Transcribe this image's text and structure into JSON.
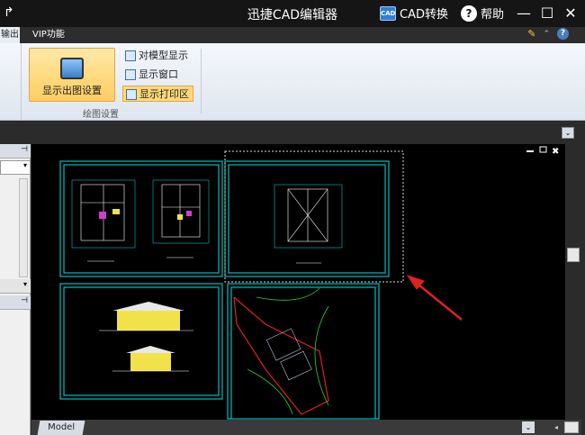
{
  "titlebar": {
    "title": "迅捷CAD编辑器",
    "left_icon": "share-arrow-icon",
    "cad_convert_label": "CAD转换",
    "help_label": "帮助",
    "cad_icon_text": "CAD"
  },
  "tabs": {
    "first_label": "输出",
    "vip_label": "VIP功能"
  },
  "ribbon": {
    "big_button_label": "显示出图设置",
    "items": [
      {
        "label": "对模型显示",
        "active": false
      },
      {
        "label": "显示窗口",
        "active": false
      },
      {
        "label": "显示打印区",
        "active": true
      }
    ],
    "group_label": "绘图设置"
  },
  "left_panel": {
    "pin_icon": "pin-icon"
  },
  "bottom": {
    "model_tab": "Model"
  },
  "colors": {
    "accent": "#ffcd5e",
    "drawing_line": "#00e5e5",
    "arrow": "#e02020",
    "background": "#000000"
  }
}
